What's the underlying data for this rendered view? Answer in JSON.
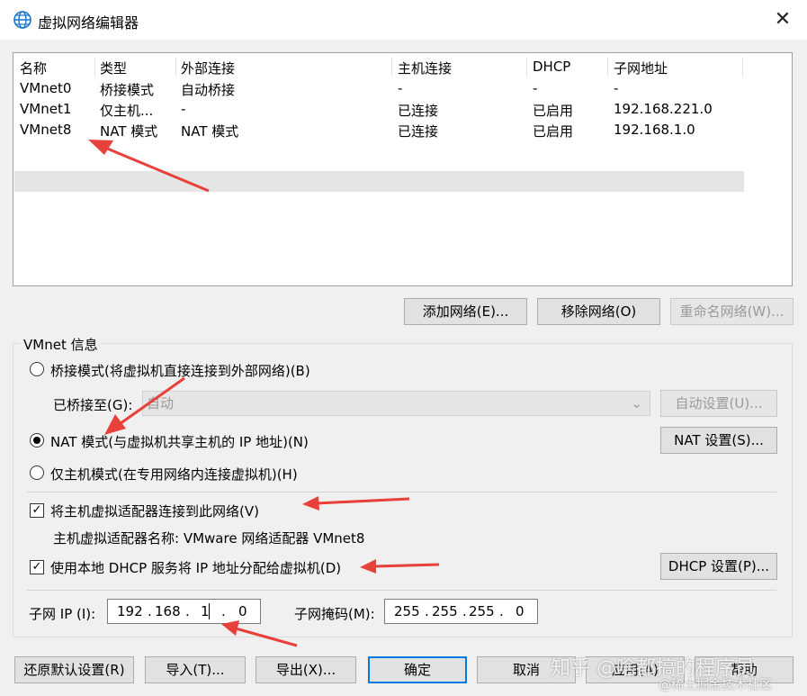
{
  "window": {
    "title": "虚拟网络编辑器",
    "close": "✕"
  },
  "table": {
    "columns": [
      "名称",
      "类型",
      "外部连接",
      "主机连接",
      "DHCP",
      "子网地址"
    ],
    "rows": [
      [
        "VMnet0",
        "桥接模式",
        "自动桥接",
        "-",
        "-",
        "-"
      ],
      [
        "VMnet1",
        "仅主机...",
        "-",
        "已连接",
        "已启用",
        "192.168.221.0"
      ],
      [
        "VMnet8",
        "NAT 模式",
        "NAT 模式",
        "已连接",
        "已启用",
        "192.168.1.0"
      ]
    ],
    "selected_row": 2
  },
  "list_buttons": {
    "add": "添加网络(E)...",
    "remove": "移除网络(O)",
    "rename": "重命名网络(W)..."
  },
  "vmnet_info": {
    "group_label": "VMnet 信息",
    "bridged_radio": "桥接模式(将虚拟机直接连接到外部网络)(B)",
    "bridged_to_label": "已桥接至(G):",
    "bridged_to_value": "自动",
    "auto_settings": "自动设置(U)...",
    "nat_radio": "NAT 模式(与虚拟机共享主机的 IP 地址)(N)",
    "nat_settings": "NAT 设置(S)...",
    "hostonly_radio": "仅主机模式(在专用网络内连接虚拟机)(H)",
    "selected_mode": "nat",
    "connect_adapter_check": "将主机虚拟适配器连接到此网络(V)",
    "connect_adapter_checked": true,
    "adapter_name": "主机虚拟适配器名称: VMware 网络适配器 VMnet8",
    "dhcp_check": "使用本地 DHCP 服务将 IP 地址分配给虚拟机(D)",
    "dhcp_checked": true,
    "dhcp_settings": "DHCP 设置(P)...",
    "subnet_ip_label": "子网 IP (I):",
    "subnet_ip": [
      "192",
      "168",
      "1",
      "0"
    ],
    "subnet_mask_label": "子网掩码(M):",
    "subnet_mask": [
      "255",
      "255",
      "255",
      "0"
    ]
  },
  "bottom_buttons": {
    "restore": "还原默认设置(R)",
    "import": "导入(T)...",
    "export": "导出(X)...",
    "ok": "确定",
    "cancel": "取消",
    "apply": "应用(A)",
    "help": "帮助"
  },
  "watermark": {
    "line1": "知乎 @啥都搞的程序员",
    "line2": "@稀土掘金技术社区"
  },
  "colors": {
    "accent": "#0078d7",
    "annotation_arrow": "#e8403a",
    "title_icon": "#1a73c9"
  }
}
